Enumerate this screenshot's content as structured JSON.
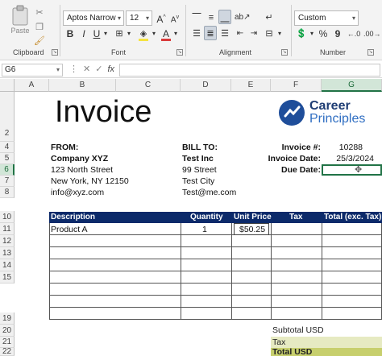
{
  "ribbon": {
    "clipboard": {
      "paste_label": "Paste",
      "group_label": "Clipboard"
    },
    "font": {
      "font_name": "Aptos Narrow",
      "font_size": "12",
      "grow": "A",
      "shrink": "A",
      "bold": "B",
      "italic": "I",
      "underline": "U",
      "group_label": "Font",
      "fill_color": "#f5e342",
      "font_color": "#d93a3a"
    },
    "alignment": {
      "group_label": "Alignment"
    },
    "number": {
      "format": "Custom",
      "percent": "%",
      "comma": "9",
      "currency": "$",
      "group_label": "Number"
    }
  },
  "formula_bar": {
    "name_box": "G6",
    "fx": "fx",
    "value": ""
  },
  "columns": [
    "A",
    "B",
    "C",
    "D",
    "E",
    "F",
    "G"
  ],
  "active_column": "G",
  "rows": [
    "2",
    "4",
    "5",
    "6",
    "7",
    "8",
    "10",
    "11",
    "12",
    "13",
    "14",
    "15",
    "19",
    "20",
    "21",
    "22"
  ],
  "active_row": "6",
  "invoice": {
    "title": "Invoice",
    "logo": {
      "line1": "Career",
      "line2": "Principles",
      "color": "#1f4e9a"
    },
    "from": {
      "label": "FROM:",
      "company": "Company XYZ",
      "street": "123 North Street",
      "city": "New York, NY 12150",
      "email": "info@xyz.com"
    },
    "bill_to": {
      "label": "BILL TO:",
      "company": "Test Inc",
      "street": "99 Street",
      "city": "Test City",
      "email": "Test@me.com"
    },
    "meta": {
      "invoice_no_label": "Invoice #:",
      "invoice_no": "10288",
      "date_label": "Invoice Date:",
      "date": "25/3/2024",
      "due_label": "Due Date:",
      "due": ""
    },
    "table": {
      "headers": [
        "Description",
        "Quantity",
        "Unit Price",
        "Tax",
        "Total (exc. Tax)"
      ],
      "header_color": "#0c2a6a",
      "rows": [
        {
          "description": "Product A",
          "quantity": "1",
          "unit_price": "$50.25",
          "tax": "",
          "total": ""
        },
        {
          "description": "",
          "quantity": "",
          "unit_price": "",
          "tax": "",
          "total": ""
        },
        {
          "description": "",
          "quantity": "",
          "unit_price": "",
          "tax": "",
          "total": ""
        },
        {
          "description": "",
          "quantity": "",
          "unit_price": "",
          "tax": "",
          "total": ""
        },
        {
          "description": "",
          "quantity": "",
          "unit_price": "",
          "tax": "",
          "total": ""
        },
        {
          "description": "",
          "quantity": "",
          "unit_price": "",
          "tax": "",
          "total": ""
        },
        {
          "description": "",
          "quantity": "",
          "unit_price": "",
          "tax": "",
          "total": ""
        },
        {
          "description": "",
          "quantity": "",
          "unit_price": "",
          "tax": "",
          "total": ""
        }
      ]
    },
    "summary": {
      "subtotal_label": "Subtotal USD",
      "tax_label": "Tax",
      "total_label": "Total USD"
    }
  }
}
